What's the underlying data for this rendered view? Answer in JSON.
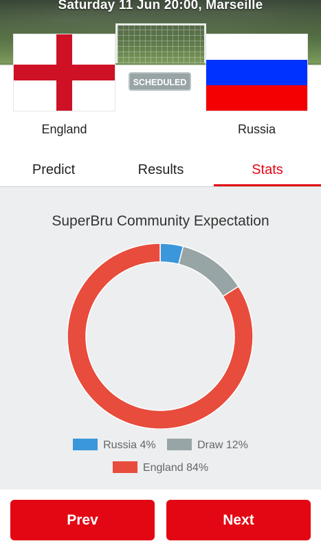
{
  "match": {
    "info": "Saturday 11 Jun 20:00, Marseille",
    "status": "SCHEDULED",
    "home_team": "England",
    "away_team": "Russia"
  },
  "tabs": [
    {
      "label": "Predict",
      "active": false
    },
    {
      "label": "Results",
      "active": false
    },
    {
      "label": "Stats",
      "active": true
    }
  ],
  "stats": {
    "title": "SuperBru Community Expectation"
  },
  "chart_data": {
    "type": "pie",
    "donut": true,
    "title": "SuperBru Community Expectation",
    "categories": [
      "Russia",
      "Draw",
      "England"
    ],
    "values": [
      4,
      12,
      84
    ],
    "colors": [
      "#3b97db",
      "#98a5a6",
      "#e74c3c"
    ],
    "legend_labels": [
      "Russia 4%",
      "Draw 12%",
      "England 84%"
    ],
    "legend_placement": "bottom"
  },
  "buttons": {
    "prev_label": "Prev",
    "next_label": "Next"
  },
  "colors": {
    "accent": "#e30613",
    "stats_bg": "#eceeef",
    "badge": "#98a4a6"
  },
  "icons": {
    "home_flag": "england-flag-icon",
    "away_flag": "russia-flag-icon"
  }
}
